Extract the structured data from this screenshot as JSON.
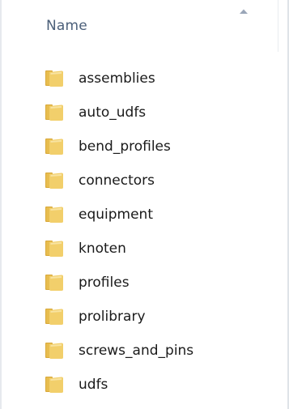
{
  "header": {
    "name_label": "Name",
    "sort_icon": "sort-ascending-icon"
  },
  "colors": {
    "header_text": "#4c607a",
    "item_text": "#1a1a1a",
    "folder_body": "#f2cf6b",
    "folder_dark": "#d9a93a"
  },
  "folders": [
    {
      "name": "assemblies",
      "icon": "folder-icon"
    },
    {
      "name": "auto_udfs",
      "icon": "folder-icon"
    },
    {
      "name": "bend_profiles",
      "icon": "folder-icon"
    },
    {
      "name": "connectors",
      "icon": "folder-icon"
    },
    {
      "name": "equipment",
      "icon": "folder-icon"
    },
    {
      "name": "knoten",
      "icon": "folder-icon"
    },
    {
      "name": "profiles",
      "icon": "folder-icon"
    },
    {
      "name": "prolibrary",
      "icon": "folder-icon"
    },
    {
      "name": "screws_and_pins",
      "icon": "folder-icon"
    },
    {
      "name": "udfs",
      "icon": "folder-icon"
    }
  ]
}
